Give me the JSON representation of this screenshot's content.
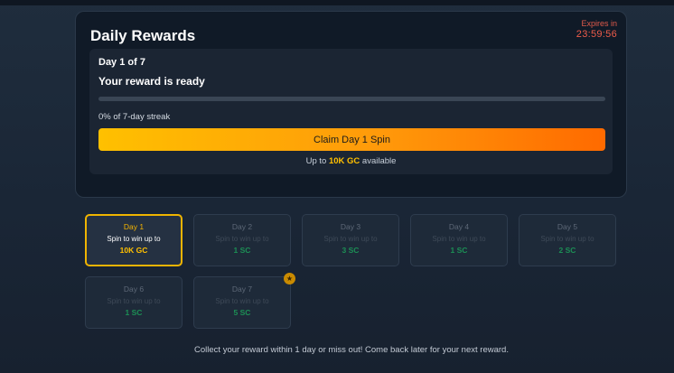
{
  "header": {
    "title": "Daily Rewards",
    "expires_label": "Expires in",
    "expires_time": "23:59:56"
  },
  "status": {
    "day_of": "Day 1 of 7",
    "ready_text": "Your reward is ready",
    "streak_progress": 0,
    "streak_text": "0% of 7-day streak",
    "claim_label": "Claim Day 1 Spin",
    "upto_prefix": "Up to",
    "upto_amount": "10K GC",
    "upto_suffix": "available"
  },
  "days": [
    {
      "name": "Day 1",
      "desc": "Spin to win up to",
      "amount": "10K GC",
      "state": "active"
    },
    {
      "name": "Day 2",
      "desc": "Spin to win up to",
      "amount": "1 SC",
      "state": "locked"
    },
    {
      "name": "Day 3",
      "desc": "Spin to win up to",
      "amount": "3 SC",
      "state": "locked"
    },
    {
      "name": "Day 4",
      "desc": "Spin to win up to",
      "amount": "1 SC",
      "state": "locked"
    },
    {
      "name": "Day 5",
      "desc": "Spin to win up to",
      "amount": "2 SC",
      "state": "locked"
    },
    {
      "name": "Day 6",
      "desc": "Spin to win up to",
      "amount": "1 SC",
      "state": "locked"
    },
    {
      "name": "Day 7",
      "desc": "Spin to win up to",
      "amount": "5 SC",
      "state": "locked",
      "badge_icon": "star-icon"
    }
  ],
  "footer": {
    "text": "Collect your reward within 1 day or miss out! Come back later for your next reward."
  },
  "colors": {
    "accent": "#ffc000",
    "gradient_end": "#ff6a00",
    "timer": "#ef5c4a",
    "sc_green": "#1c8f55"
  }
}
